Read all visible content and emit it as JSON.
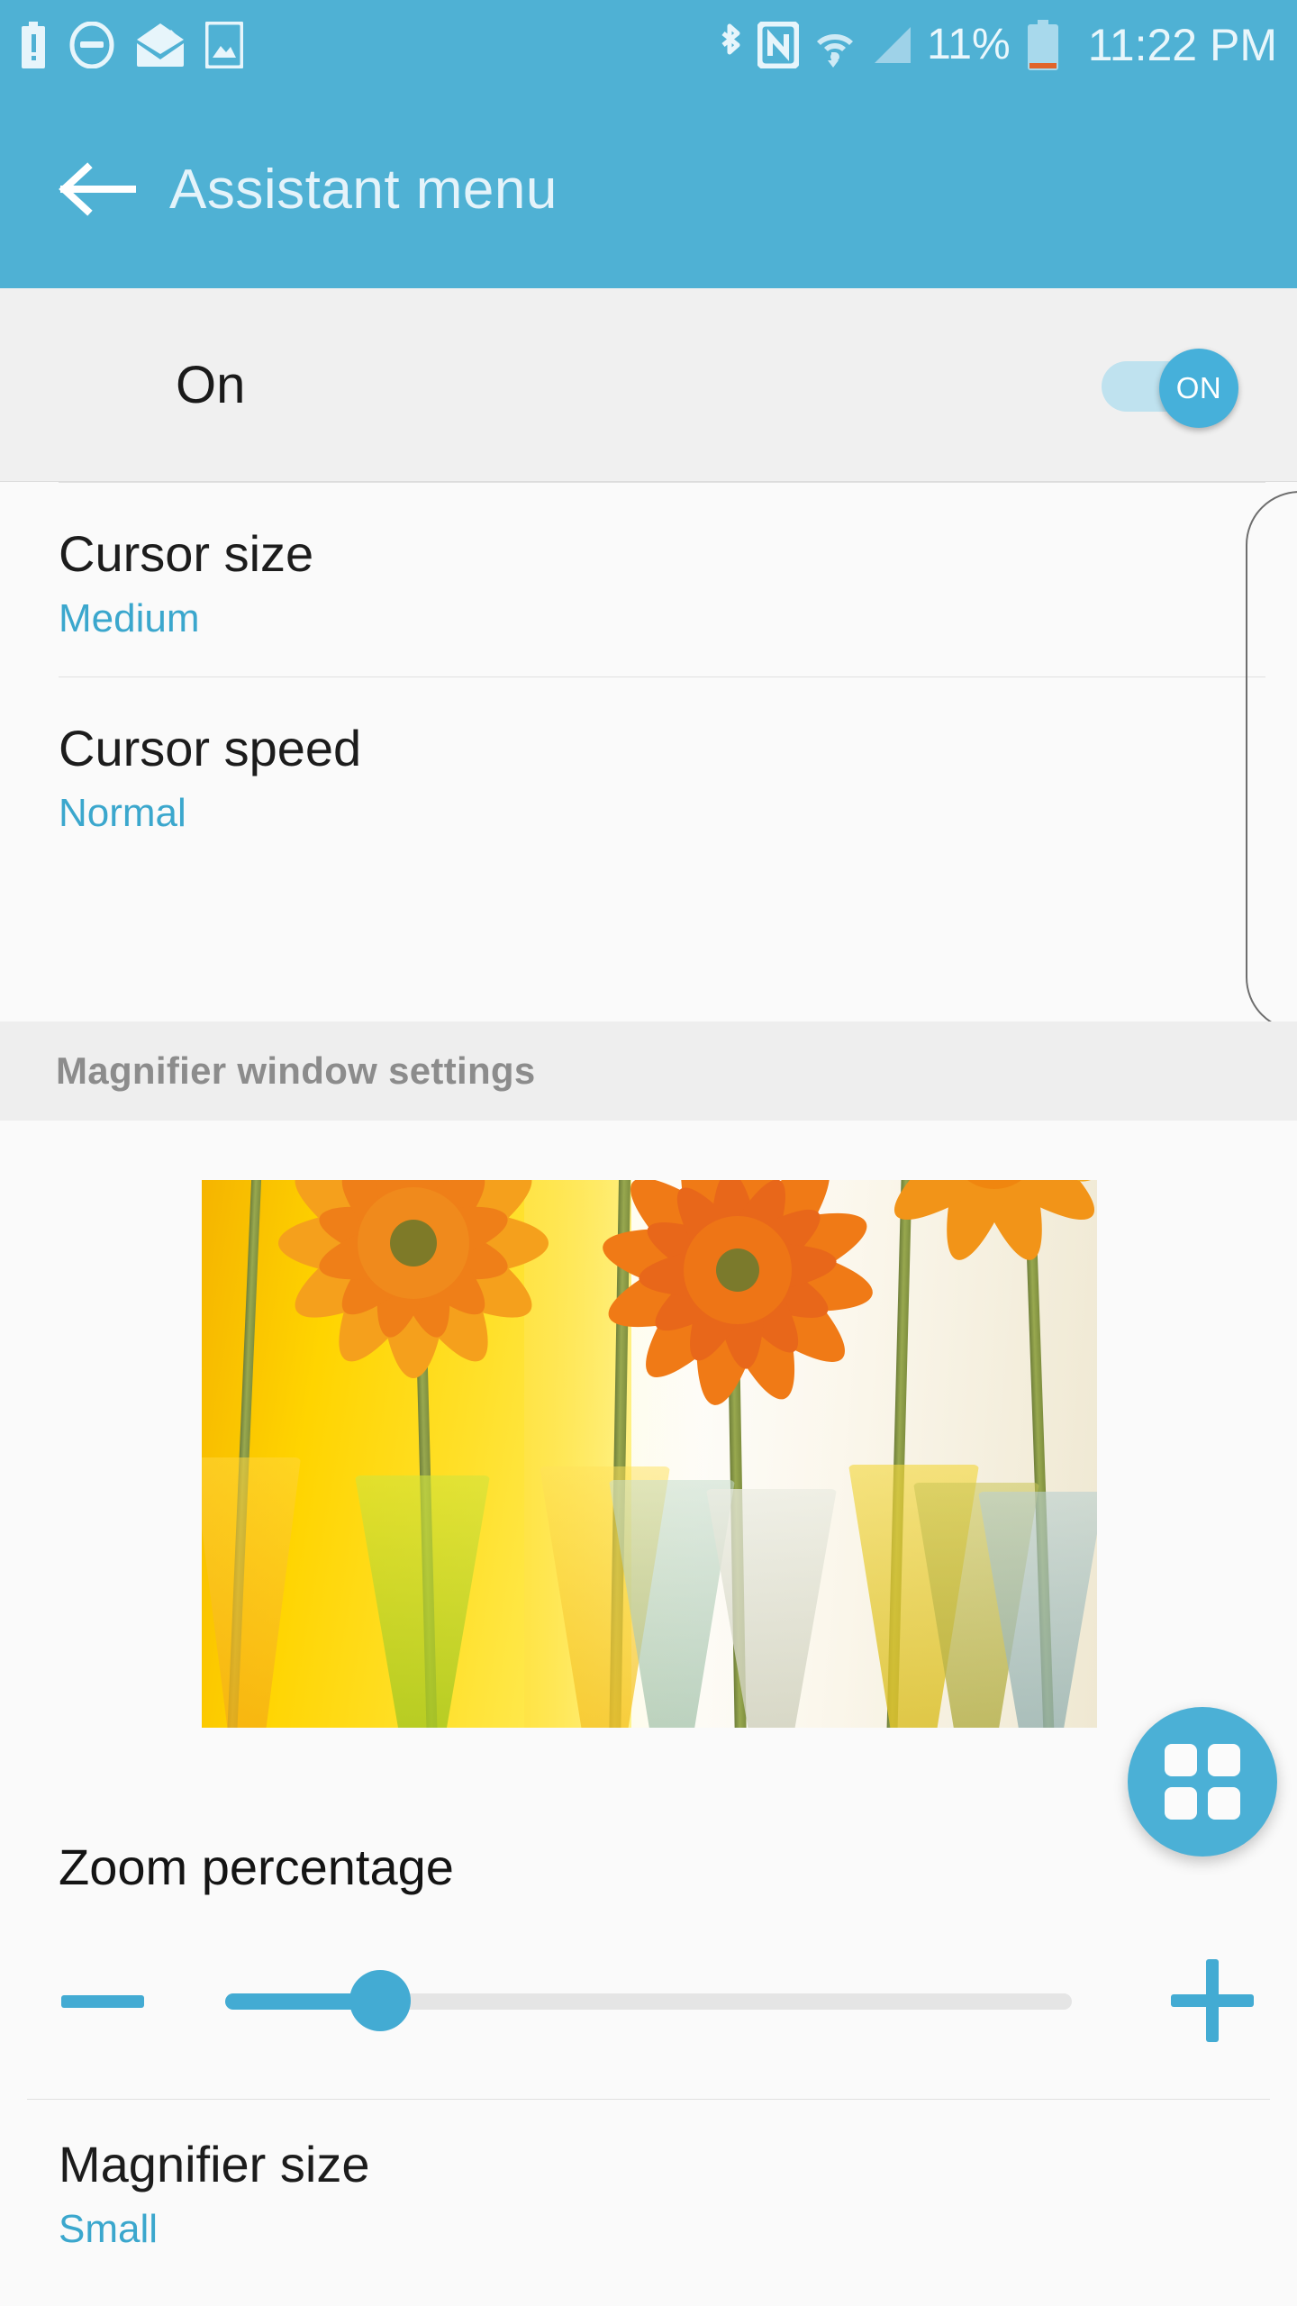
{
  "status_bar": {
    "left_icons": [
      "battery-alert-icon",
      "do-not-disturb-icon",
      "mail-read-icon",
      "gallery-image-icon"
    ],
    "right_icons": [
      "bluetooth-icon",
      "nfc-icon",
      "wifi-icon",
      "cellular-signal-icon"
    ],
    "battery_percent": "11%",
    "clock": "11:22 PM"
  },
  "app_bar": {
    "back_icon": "back-arrow-icon",
    "title": "Assistant menu"
  },
  "master_switch": {
    "label": "On",
    "state_label": "ON",
    "enabled": true
  },
  "settings": [
    {
      "title": "Cursor size",
      "value": "Medium"
    },
    {
      "title": "Cursor speed",
      "value": "Normal"
    }
  ],
  "section": {
    "header": "Magnifier window settings"
  },
  "preview": {
    "alt": "magnifier-preview-flowers-in-vases"
  },
  "fab": {
    "icon": "grid-apps-icon"
  },
  "zoom_percentage": {
    "title": "Zoom percentage",
    "decrease_label": "−",
    "increase_label": "+",
    "value_ratio": 0.16
  },
  "magnifier_size": {
    "title": "Magnifier size",
    "value": "Small"
  },
  "colors": {
    "accent": "#4fb1d4",
    "accent_text": "#3ba7cd",
    "status_bar": "#4fb1d4",
    "battery_warning": "#e0642a",
    "page_bg": "#fafafa",
    "row_bg": "#f0f0f0",
    "section_bg": "#eeeeee"
  }
}
